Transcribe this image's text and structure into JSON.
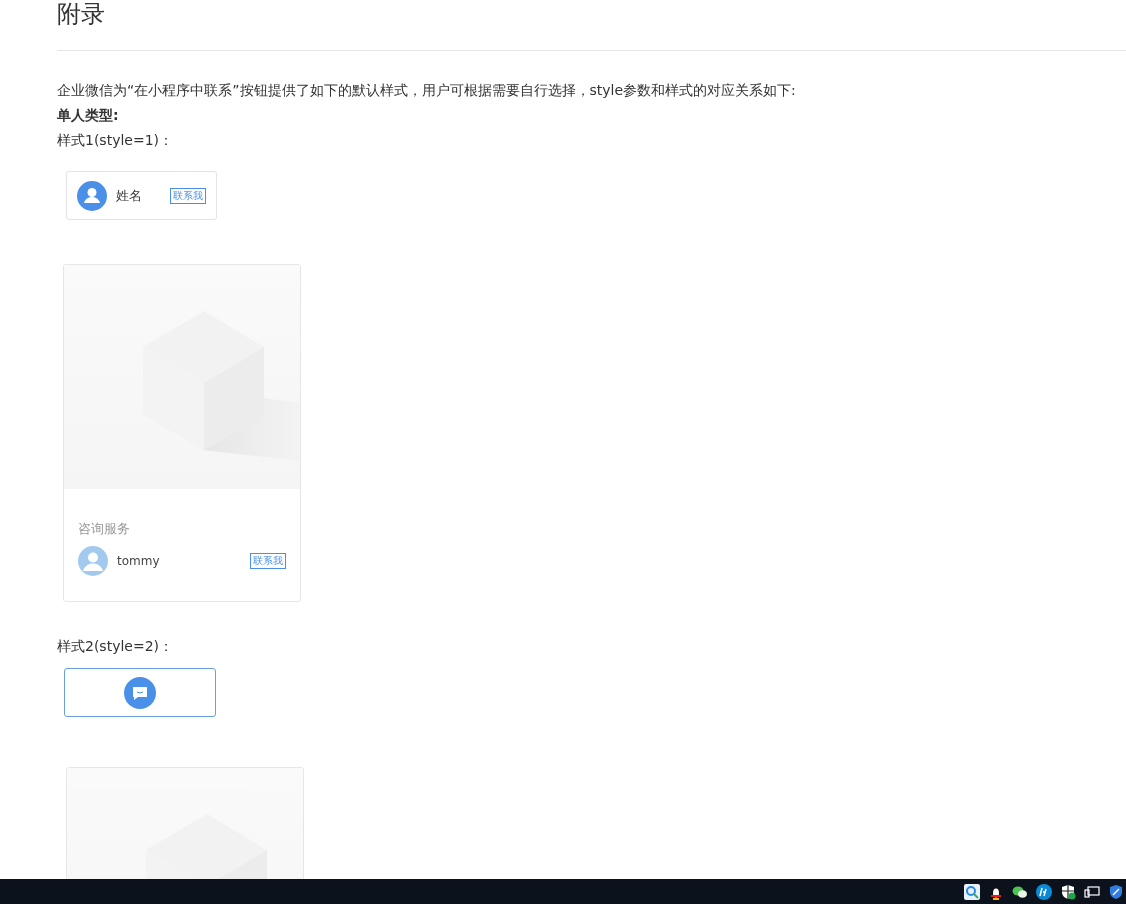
{
  "heading": "附录",
  "intro": "企业微信为“在小程序中联系”按钮提供了如下的默认样式，用户可根据需要自行选择，style参数和样式的对应关系如下:",
  "subheading": "单人类型:",
  "styles": [
    {
      "label": "样式1(style=1)：",
      "kind": "name",
      "name": "姓名",
      "button": "联系我",
      "card": {
        "kind": "contact",
        "title": "咨询服务",
        "name": "tommy",
        "button": "联系我"
      }
    },
    {
      "label": "样式2(style=2)：",
      "kind": "icon"
    }
  ]
}
